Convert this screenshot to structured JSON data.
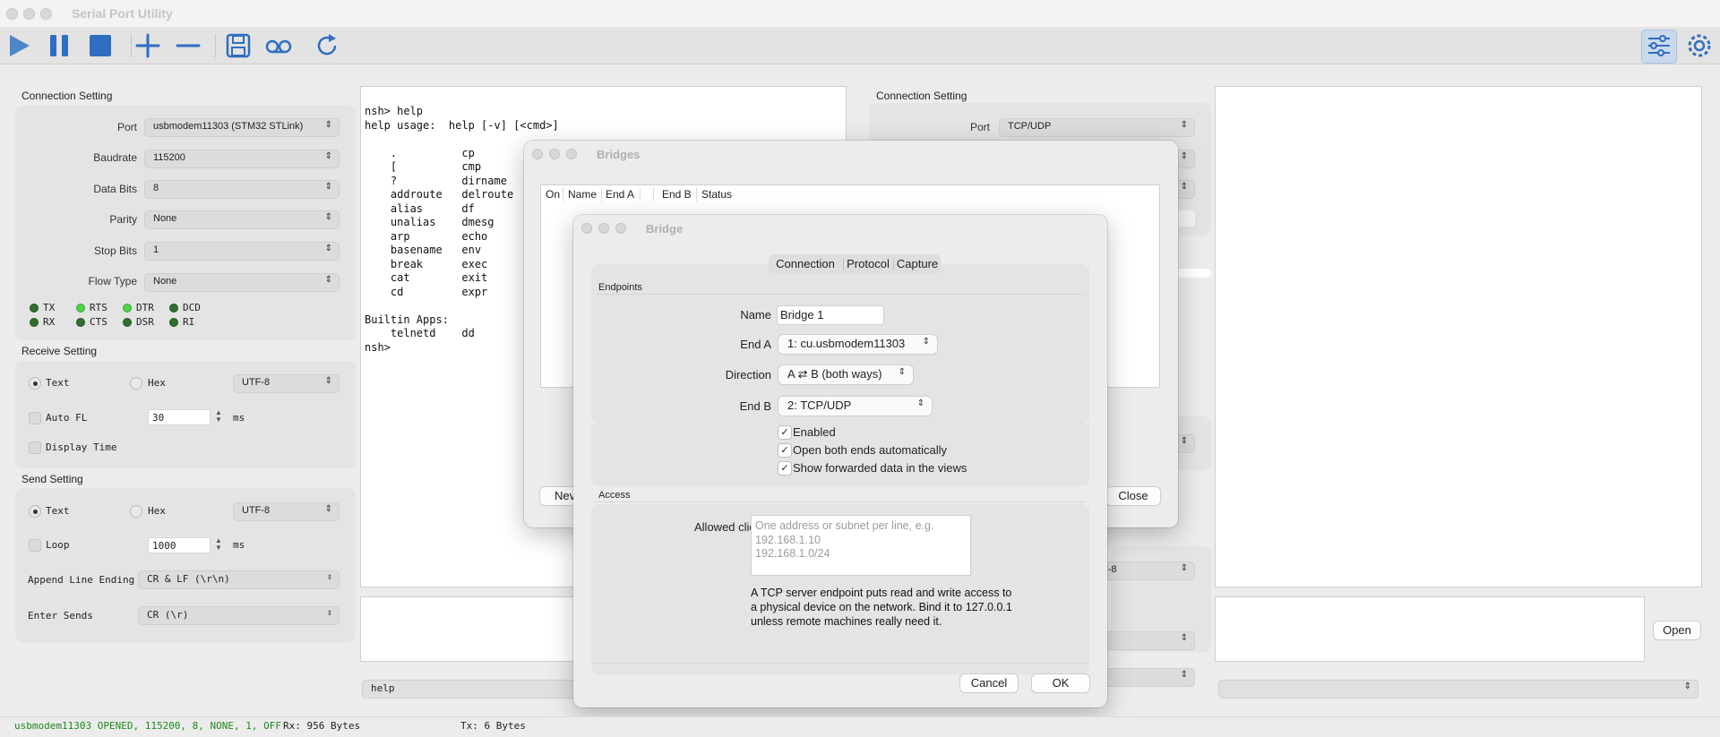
{
  "app": {
    "title": "Serial Port Utility"
  },
  "left": {
    "connection": {
      "title": "Connection Setting",
      "fields": [
        {
          "label": "Port",
          "value": "usbmodem11303 (STM32 STLink)"
        },
        {
          "label": "Baudrate",
          "value": "115200"
        },
        {
          "label": "Data Bits",
          "value": "8"
        },
        {
          "label": "Parity",
          "value": "None"
        },
        {
          "label": "Stop Bits",
          "value": "1"
        },
        {
          "label": "Flow Type",
          "value": "None"
        }
      ],
      "signals": [
        "TX",
        "RTS",
        "DTR",
        "DCD",
        "RX",
        "CTS",
        "DSR",
        "RI"
      ]
    },
    "receive": {
      "title": "Receive Setting",
      "text": "Text",
      "hex": "Hex",
      "encoding": "UTF-8",
      "auto_fl": "Auto FL",
      "auto_fl_value": "30",
      "unit": "ms",
      "display_time": "Display Time"
    },
    "send": {
      "title": "Send Setting",
      "text": "Text",
      "hex": "Hex",
      "encoding": "UTF-8",
      "loop": "Loop",
      "loop_value": "1000",
      "unit": "ms",
      "append_label": "Append Line Ending",
      "append_value": "CR & LF (\\r\\n)",
      "enter_label": "Enter Sends",
      "enter_value": "CR (\\r)"
    }
  },
  "terminal": {
    "lines": "nsh> help\nhelp usage:  help [-v] [<cmd>]\n\n    .          cp\n    [          cmp\n    ?          dirname\n    addroute   delroute\n    alias      df\n    unalias    dmesg\n    arp        echo\n    basename   env\n    break      exec\n    cat        exit\n    cd         expr\n\nBuiltin Apps:\n    telnetd    dd\nnsh>",
    "send_text": "help"
  },
  "right": {
    "connection": {
      "title": "Connection Setting",
      "port_label": "Port",
      "port_value": "TCP/UDP"
    },
    "encoding_partial": "F-8",
    "open_button": "Open"
  },
  "bridges": {
    "title": "Bridges",
    "columns": [
      "On",
      "Name",
      "End A",
      "",
      "End B",
      "Status"
    ],
    "new_partial": "Nev",
    "close": "Close"
  },
  "bridge": {
    "title": "Bridge",
    "tabs": [
      "Connection",
      "Protocol",
      "Capture"
    ],
    "endpoints_title": "Endpoints",
    "name_label": "Name",
    "name_value": "Bridge 1",
    "end_a_label": "End A",
    "end_a_value": "1: cu.usbmodem11303",
    "direction_label": "Direction",
    "direction_value": "A ⇄ B (both ways)",
    "end_b_label": "End B",
    "end_b_value": "2: TCP/UDP",
    "checks": [
      "Enabled",
      "Open both ends automatically",
      "Show forwarded data in the views"
    ],
    "access_title": "Access",
    "allowed_label": "Allowed clients",
    "allowed_placeholder": "One address or subnet per line, e.g.\n192.168.1.10\n192.168.1.0/24",
    "note": "A TCP server endpoint puts read and write access to\na physical device on the network. Bind it to 127.0.0.1\nunless remote machines really need it.",
    "cancel": "Cancel",
    "ok": "OK"
  },
  "status": {
    "port": "usbmodem11303 OPENED, 115200, 8, NONE, 1, OFF",
    "rx": "Rx: 956 Bytes",
    "tx": "Tx: 6 Bytes"
  },
  "colors": {
    "led_on": "#4dd44d",
    "led_off": "#2f6f2f",
    "status_green": "#1d8a1d",
    "accent": "#2f6ec0"
  }
}
